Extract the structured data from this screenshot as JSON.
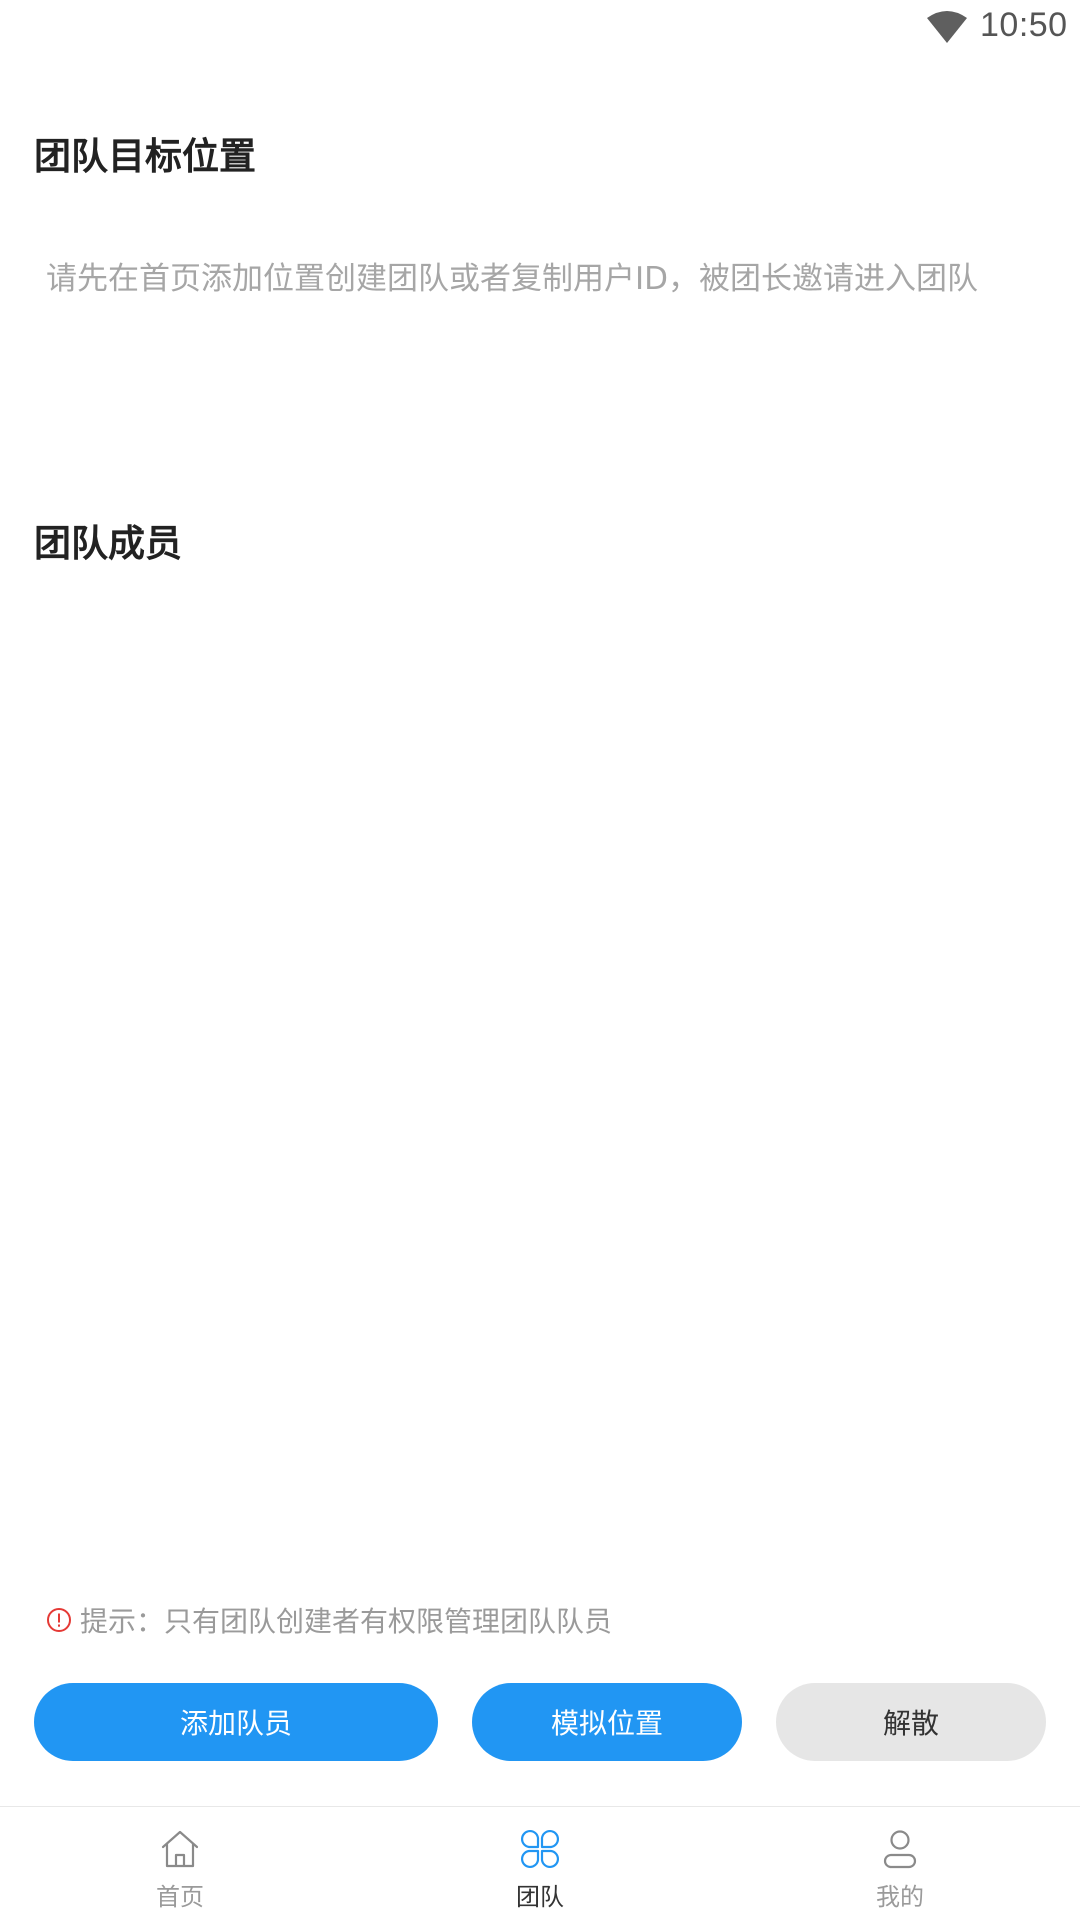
{
  "status_bar": {
    "time": "10:50",
    "wifi_icon": "wifi-icon"
  },
  "target_section": {
    "title": "团队目标位置",
    "hint": "请先在首页添加位置创建团队或者复制用户ID，被团长邀请进入团队"
  },
  "members_section": {
    "title": "团队成员",
    "members": []
  },
  "tip": {
    "icon": "alert-circle-icon",
    "text": "提示：只有团队创建者有权限管理团队队员",
    "icon_color": "#e53935"
  },
  "actions": {
    "add_member": "添加队员",
    "simulate_location": "模拟位置",
    "disband": "解散"
  },
  "bottom_nav": {
    "items": [
      {
        "label": "首页",
        "icon": "home-icon",
        "active": false
      },
      {
        "label": "团队",
        "icon": "team-grid-icon",
        "active": true
      },
      {
        "label": "我的",
        "icon": "user-icon",
        "active": false
      }
    ]
  },
  "colors": {
    "primary": "#2196f3",
    "secondary_button": "#e6e6e6",
    "hint_text": "#a6a6a6"
  }
}
